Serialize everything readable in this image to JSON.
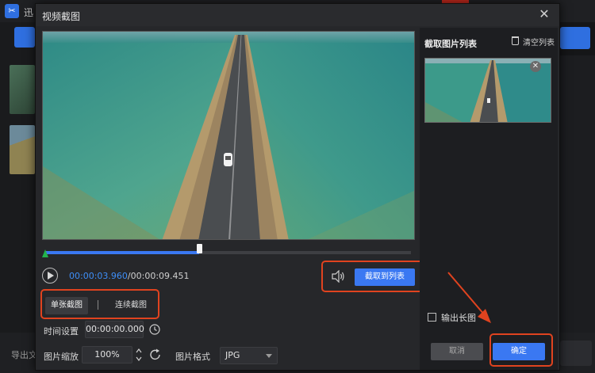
{
  "app": {
    "title": "迅",
    "export_label": "导出文"
  },
  "dialog": {
    "title": "视频截图",
    "close_glyph": "✕"
  },
  "player": {
    "current_time": "00:00:03.960",
    "separator": "/",
    "total_time": "00:00:09.451",
    "progress": 0.42
  },
  "capture": {
    "button_label": "截取到列表"
  },
  "modes": {
    "single_label": "单张截图",
    "continuous_label": "连续截图"
  },
  "settings": {
    "time_label": "时间设置",
    "time_value": "00:00:00.000",
    "scale_label": "图片缩放",
    "scale_value": "100%",
    "format_label": "图片格式",
    "format_value": "JPG"
  },
  "list_panel": {
    "title": "截取图片列表",
    "clear_label": "清空列表",
    "thumb_close_glyph": "✕"
  },
  "output": {
    "long_image_label": "输出长图",
    "long_image_checked": false
  },
  "footer": {
    "cancel_label": "取消",
    "ok_label": "确定"
  },
  "colors": {
    "accent": "#3a78f2",
    "highlight": "#e0431f",
    "timeline_start": "#22b24c"
  }
}
